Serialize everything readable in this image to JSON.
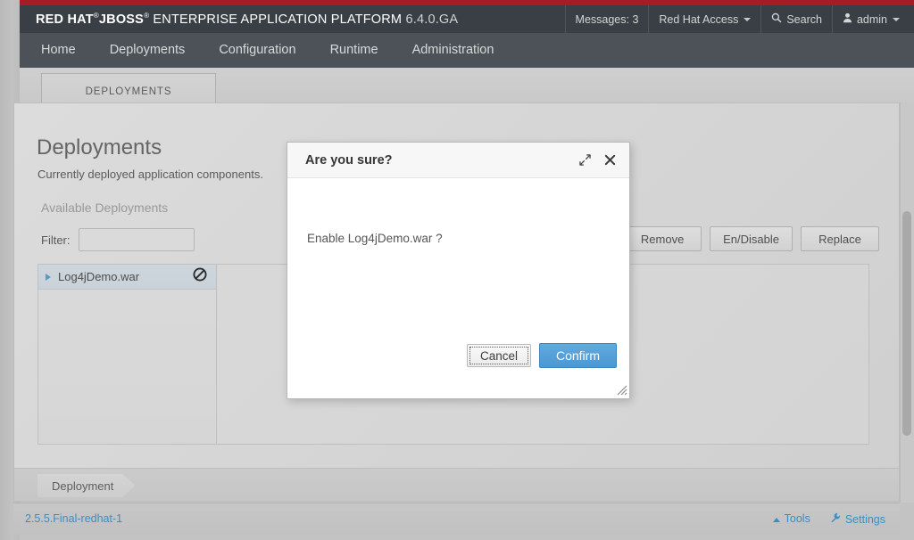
{
  "masthead": {
    "brand_bold": "RED HAT",
    "brand_sup1": "®",
    "brand_jboss": "JBOSS",
    "brand_sup2": "®",
    "brand_rest": "ENTERPRISE APPLICATION PLATFORM",
    "version": "6.4.0.GA",
    "messages": "Messages: 3",
    "red_hat_access": "Red Hat Access",
    "search": "Search",
    "user": "admin",
    "search_icon": "search-icon",
    "user_icon": "user-icon"
  },
  "nav": {
    "items": [
      {
        "label": "Home"
      },
      {
        "label": "Deployments"
      },
      {
        "label": "Configuration"
      },
      {
        "label": "Runtime"
      },
      {
        "label": "Administration"
      }
    ]
  },
  "tabs": {
    "active": "DEPLOYMENTS"
  },
  "page": {
    "title": "Deployments",
    "subtitle": "Currently deployed application components.",
    "section_header": "Available Deployments",
    "filter_label": "Filter:",
    "filter_value": "",
    "filter_placeholder": "",
    "buttons": [
      {
        "label": "Remove"
      },
      {
        "label": "En/Disable"
      },
      {
        "label": "Replace"
      }
    ],
    "deployments": [
      {
        "name": "Log4jDemo.war",
        "status_icon": "disabled-icon",
        "selected": true
      }
    ],
    "breadcrumb": "Deployment"
  },
  "footer": {
    "version": "2.5.5.Final-redhat-1",
    "tools": "Tools",
    "settings": "Settings",
    "tools_icon": "caret-up-icon",
    "settings_icon": "wrench-icon"
  },
  "modal": {
    "title": "Are you sure?",
    "message": "Enable Log4jDemo.war ?",
    "cancel": "Cancel",
    "confirm": "Confirm",
    "maximize_icon": "maximize-icon",
    "close_icon": "close-icon",
    "resize_icon": "resize-grip-icon"
  },
  "colors": {
    "brand_red": "#a81b21",
    "masthead": "#393f44",
    "navbar": "#4d5258",
    "accent_link": "#3a8fc0",
    "confirm_blue": "#4a98d4"
  }
}
